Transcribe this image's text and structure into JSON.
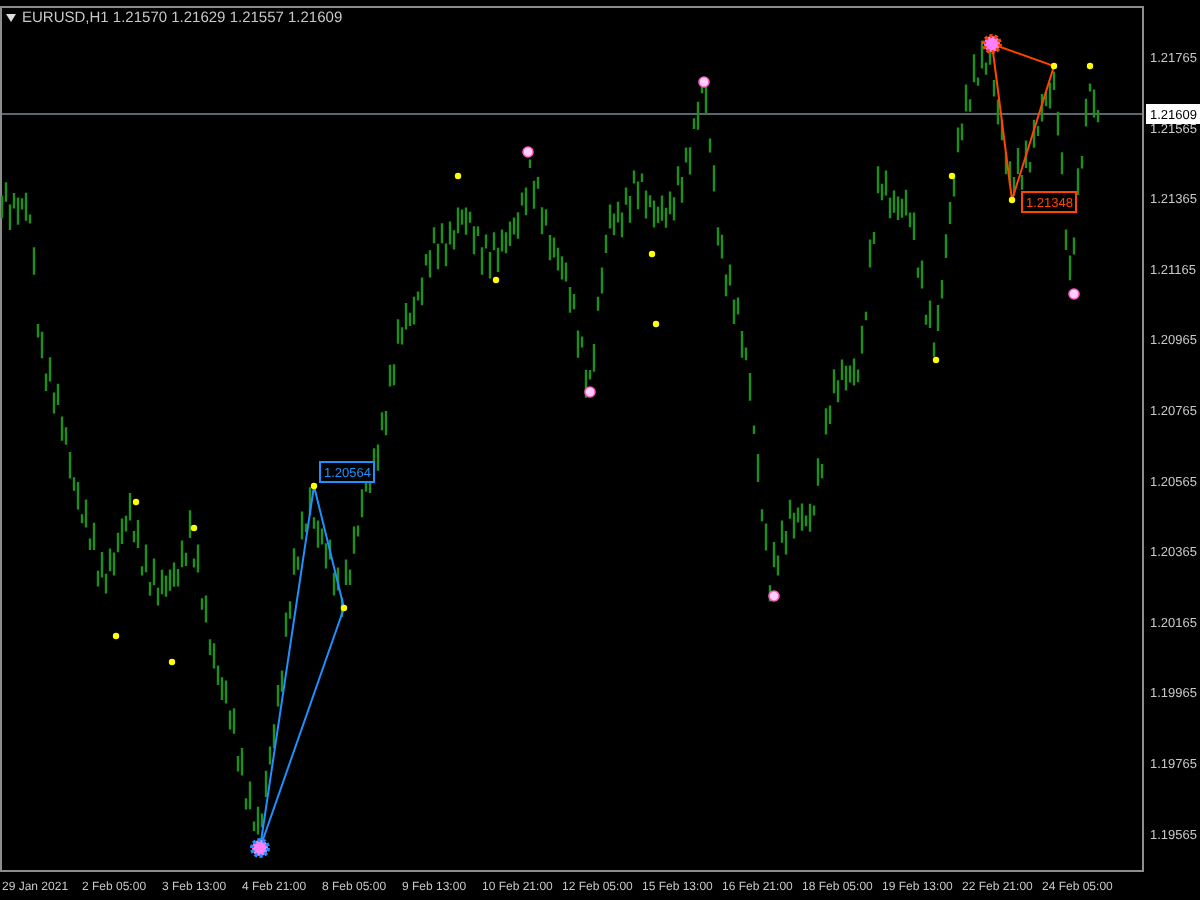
{
  "symbol_bar": {
    "symbol": "EURUSD,H1",
    "quotes": [
      "1.21570",
      "1.21629",
      "1.21557",
      "1.21609"
    ]
  },
  "price_axis": [
    "1.21765",
    "1.21565",
    "1.21365",
    "1.21165",
    "1.20965",
    "1.20765",
    "1.20565",
    "1.20365",
    "1.20165",
    "1.19965",
    "1.19765",
    "1.19565"
  ],
  "current_price": "1.21609",
  "time_axis": [
    "29 Jan 2021",
    "2 Feb 05:00",
    "3 Feb 13:00",
    "4 Feb 21:00",
    "8 Feb 05:00",
    "9 Feb 13:00",
    "10 Feb 21:00",
    "12 Feb 05:00",
    "15 Feb 13:00",
    "16 Feb 21:00",
    "18 Feb 05:00",
    "19 Feb 13:00",
    "22 Feb 21:00",
    "24 Feb 05:00"
  ],
  "patterns": [
    {
      "label": "1.20564",
      "color": "#1e90ff"
    },
    {
      "label": "1.21348",
      "color": "#ff4500"
    }
  ]
}
